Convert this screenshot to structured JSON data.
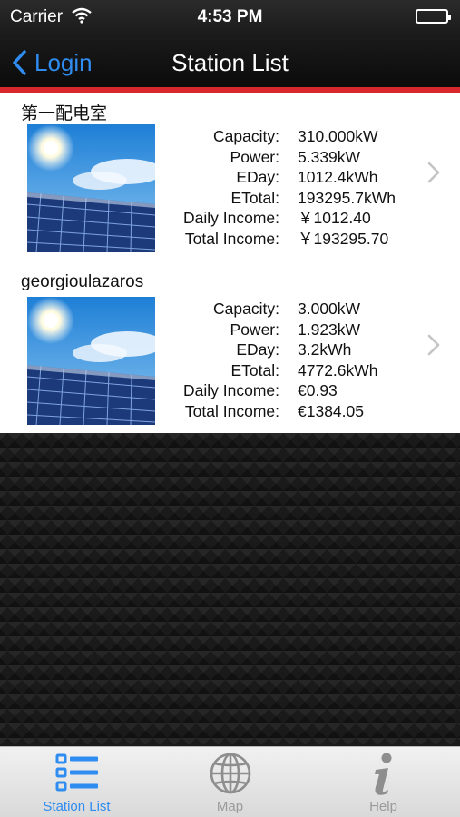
{
  "status_bar": {
    "carrier": "Carrier",
    "time": "4:53 PM",
    "battery_level": 1.0
  },
  "nav": {
    "back_label": "Login",
    "title": "Station List"
  },
  "colors": {
    "accent": "#2f8cf0",
    "divider": "#d9272e",
    "tab_inactive": "#9a9a9a"
  },
  "stations": [
    {
      "name": "第一配电室",
      "fields": [
        {
          "label": "Capacity:",
          "value": "310.000kW"
        },
        {
          "label": "Power:",
          "value": "5.339kW"
        },
        {
          "label": "EDay:",
          "value": "1012.4kWh"
        },
        {
          "label": "ETotal:",
          "value": "193295.7kWh"
        },
        {
          "label": "Daily Income:",
          "value": "￥1012.40"
        },
        {
          "label": "Total Income:",
          "value": "￥193295.70"
        }
      ]
    },
    {
      "name": "georgioulazaros",
      "fields": [
        {
          "label": "Capacity:",
          "value": "3.000kW"
        },
        {
          "label": "Power:",
          "value": "1.923kW"
        },
        {
          "label": "EDay:",
          "value": "3.2kWh"
        },
        {
          "label": "ETotal:",
          "value": "4772.6kWh"
        },
        {
          "label": "Daily Income:",
          "value": "€0.93"
        },
        {
          "label": "Total Income:",
          "value": "€1384.05"
        }
      ]
    }
  ],
  "tabs": [
    {
      "label": "Station List",
      "icon": "list-icon",
      "active": true
    },
    {
      "label": "Map",
      "icon": "globe-icon",
      "active": false
    },
    {
      "label": "Help",
      "icon": "info-icon",
      "active": false
    }
  ]
}
